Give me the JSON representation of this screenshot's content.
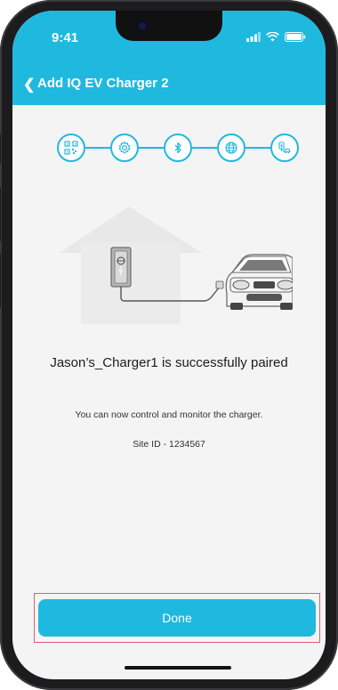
{
  "status_bar": {
    "time": "9:41"
  },
  "nav": {
    "title": "Add IQ EV Charger 2"
  },
  "stepper": {
    "steps": [
      {
        "icon": "qr-code-icon"
      },
      {
        "icon": "gear-icon"
      },
      {
        "icon": "bluetooth-icon"
      },
      {
        "icon": "globe-icon"
      },
      {
        "icon": "ev-charger-icon"
      }
    ]
  },
  "message": {
    "title": "Jason’s_Charger1 is successfully paired",
    "subtitle": "You can now control and monitor the charger.",
    "site_id": "Site ID - 1234567"
  },
  "actions": {
    "done_label": "Done"
  },
  "colors": {
    "accent": "#1fb9df",
    "background": "#f4f4f4"
  }
}
